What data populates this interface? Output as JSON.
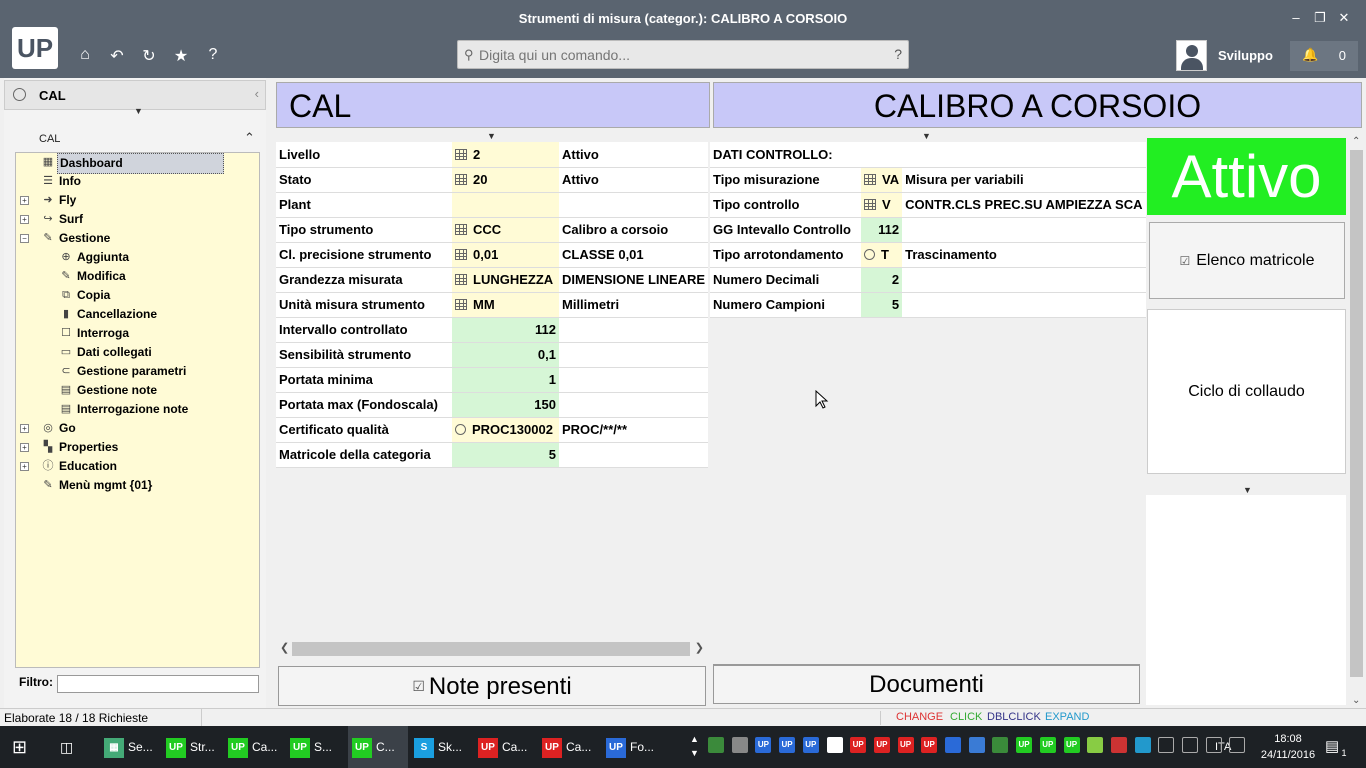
{
  "window": {
    "title": "Strumenti di misura (categor.): CALIBRO A CORSOIO",
    "min": "–",
    "restore": "❐",
    "close": "✕"
  },
  "app": {
    "logo": "UP",
    "toolbar_icons": [
      "home-icon",
      "undo-icon",
      "refresh-icon",
      "star-icon",
      "help-icon"
    ],
    "toolbar_glyphs": [
      "⌂",
      "↶",
      "↻",
      "★",
      "?"
    ]
  },
  "command": {
    "placeholder": "Digita qui un comando...",
    "help": "?"
  },
  "user": {
    "name": "Sviluppo",
    "notifications": "0"
  },
  "left": {
    "header": "CAL",
    "collapse": "‹",
    "section": "CAL",
    "filter_label": "Filtro:",
    "tree": [
      {
        "label": "Dashboard",
        "icon": "▦",
        "name": "dashboard"
      },
      {
        "label": "Info",
        "icon": "☰",
        "name": "info"
      },
      {
        "label": "Fly",
        "icon": "➜",
        "name": "fly",
        "exp": "+"
      },
      {
        "label": "Surf",
        "icon": "↪",
        "name": "surf",
        "exp": "+"
      },
      {
        "label": "Gestione",
        "icon": "✎",
        "name": "gestione",
        "exp": "−"
      },
      {
        "label": "Aggiunta",
        "icon": "⊕",
        "name": "aggiunta"
      },
      {
        "label": "Modifica",
        "icon": "✎",
        "name": "modifica"
      },
      {
        "label": "Copia",
        "icon": "⧉",
        "name": "copia"
      },
      {
        "label": "Cancellazione",
        "icon": "▮",
        "name": "cancellazione"
      },
      {
        "label": "Interroga",
        "icon": "☐",
        "name": "interroga"
      },
      {
        "label": "Dati collegati",
        "icon": "▭",
        "name": "dati-collegati"
      },
      {
        "label": "Gestione parametri",
        "icon": "⊂",
        "name": "gestione-parametri"
      },
      {
        "label": "Gestione note",
        "icon": "▤",
        "name": "gestione-note"
      },
      {
        "label": "Interrogazione note",
        "icon": "▤",
        "name": "interrogazione-note"
      },
      {
        "label": "Go",
        "icon": "◎",
        "name": "go",
        "exp": "+"
      },
      {
        "label": "Properties",
        "icon": "▚",
        "name": "properties",
        "exp": "+"
      },
      {
        "label": "Education",
        "icon": "ⓘ",
        "name": "education",
        "exp": "+"
      },
      {
        "label": "Menù mgmt {01}",
        "icon": "✎",
        "name": "menu-mgmt"
      }
    ]
  },
  "header_left": "CAL",
  "header_right": "CALIBRO A CORSOIO",
  "form_left": [
    {
      "label": "Livello",
      "icon": "grid",
      "code": "2",
      "desc": "Attivo",
      "type": "yel"
    },
    {
      "label": "Stato",
      "icon": "grid",
      "code": "20",
      "desc": "Attivo",
      "type": "yel"
    },
    {
      "label": "Plant",
      "icon": "",
      "code": "",
      "desc": "",
      "type": "yel"
    },
    {
      "label": "Tipo strumento",
      "icon": "grid",
      "code": "CCC",
      "desc": "Calibro a corsoio",
      "type": "yel"
    },
    {
      "label": "Cl. precisione strumento",
      "icon": "grid",
      "code": "0,01",
      "desc": "CLASSE 0,01",
      "type": "yel"
    },
    {
      "label": "Grandezza misurata",
      "icon": "grid",
      "code": "LUNGHEZZA",
      "desc": "DIMENSIONE LINEARE",
      "type": "yel"
    },
    {
      "label": "Unità misura strumento",
      "icon": "grid",
      "code": "MM",
      "desc": "Millimetri",
      "type": "yel"
    },
    {
      "label": "Intervallo controllato",
      "icon": "",
      "code": "112",
      "desc": "",
      "type": "grn"
    },
    {
      "label": "Sensibilità strumento",
      "icon": "",
      "code": "0,1",
      "desc": "",
      "type": "grn"
    },
    {
      "label": "Portata minima",
      "icon": "",
      "code": "1",
      "desc": "",
      "type": "grn"
    },
    {
      "label": "Portata max (Fondoscala)",
      "icon": "",
      "code": "150",
      "desc": "",
      "type": "grn"
    },
    {
      "label": "Certificato qualità",
      "icon": "radio",
      "code": "PROC130002",
      "desc": "PROC/**/**",
      "type": "yel"
    },
    {
      "label": "Matricole della categoria",
      "icon": "",
      "code": "5",
      "desc": "",
      "type": "grn"
    }
  ],
  "form_right": [
    {
      "label": "DATI CONTROLLO:",
      "icon": "",
      "code": "",
      "desc": "",
      "type": "none"
    },
    {
      "label": "Tipo misurazione",
      "icon": "grid",
      "code": "VA",
      "desc": "Misura per variabili",
      "type": "yel"
    },
    {
      "label": "Tipo controllo",
      "icon": "grid",
      "code": "V",
      "desc": "CONTR.CLS PREC.SU AMPIEZZA SCA",
      "type": "yel"
    },
    {
      "label": "GG Intevallo Controllo",
      "icon": "",
      "code": "112",
      "desc": "",
      "type": "grn"
    },
    {
      "label": "Tipo arrotondamento",
      "icon": "radio",
      "code": "T",
      "desc": "Trascinamento",
      "type": "yel"
    },
    {
      "label": "Numero Decimali",
      "icon": "",
      "code": "2",
      "desc": "",
      "type": "grn"
    },
    {
      "label": "Numero Campioni",
      "icon": "",
      "code": "5",
      "desc": "",
      "type": "grn"
    }
  ],
  "buttons": {
    "note": "Note presenti",
    "documenti": "Documenti",
    "elenco": "Elenco matricole",
    "ciclo": "Ciclo di collaudo",
    "status_big": "Attivo"
  },
  "colors": {
    "status_big": "#22ee22",
    "header": "#c8c8f8",
    "code_yellow": "#fffbd6",
    "code_green": "#d6f6d6"
  },
  "status": {
    "text": "Elaborate 18 / 18 Richieste",
    "change": "CHANGE",
    "click": "CLICK",
    "dblclick": "DBLCLICK",
    "expand": "EXPAND"
  },
  "taskbar": {
    "items": [
      {
        "label": "Se...",
        "icon": "▦",
        "color": "#4a7",
        "name": "settings"
      },
      {
        "label": "Str...",
        "icon": "UP",
        "color": "#2c2",
        "name": "up-str"
      },
      {
        "label": "Ca...",
        "icon": "UP",
        "color": "#2c2",
        "name": "up-ca1"
      },
      {
        "label": "S...",
        "icon": "UP",
        "color": "#2c2",
        "name": "up-s"
      },
      {
        "label": "C...",
        "icon": "UP",
        "color": "#2c2",
        "name": "up-c",
        "active": true
      },
      {
        "label": "Sk...",
        "icon": "S",
        "color": "#1a9fe0",
        "name": "skype"
      },
      {
        "label": "Ca...",
        "icon": "UP",
        "color": "#d22",
        "name": "up-ca2"
      },
      {
        "label": "Ca...",
        "icon": "UP",
        "color": "#d22",
        "name": "up-ca3"
      },
      {
        "label": "Fo...",
        "icon": "UP",
        "color": "#2a6ad8",
        "name": "up-fo"
      }
    ],
    "lang": "ITA",
    "time": "18:08",
    "date": "24/11/2016",
    "notif_count": "1"
  }
}
